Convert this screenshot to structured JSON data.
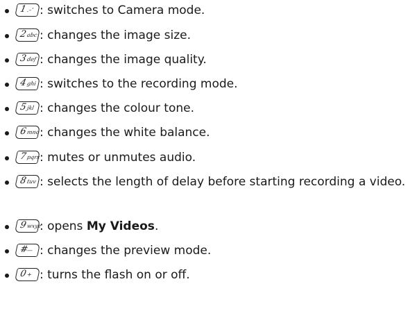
{
  "items": [
    {
      "key": "1",
      "sub": ".–’",
      "text": ": switches to Camera mode."
    },
    {
      "key": "2",
      "sub": "abc",
      "text": ": changes the image size."
    },
    {
      "key": "3",
      "sub": "def",
      "text": ": changes the image quality."
    },
    {
      "key": "4",
      "sub": "ghi",
      "text": ": switches to the recording mode."
    },
    {
      "key": "5",
      "sub": "jkl",
      "text": ": changes the colour tone."
    },
    {
      "key": "6",
      "sub": "mno",
      "text": ": changes the white balance."
    },
    {
      "key": "7",
      "sub": "pqrs",
      "text": ": mutes or unmutes audio."
    },
    {
      "key": "8",
      "sub": "tuv",
      "text": ": selects the length of delay before starting recording a video."
    },
    {
      "key": "9",
      "sub": "wxyz",
      "text_prefix": ": opens ",
      "text_bold": "My Videos",
      "text_suffix": "."
    },
    {
      "key": "#",
      "sub": "—",
      "text": ": changes the preview mode."
    },
    {
      "key": "0",
      "sub": "+",
      "text": ": turns the flash on or off."
    }
  ]
}
